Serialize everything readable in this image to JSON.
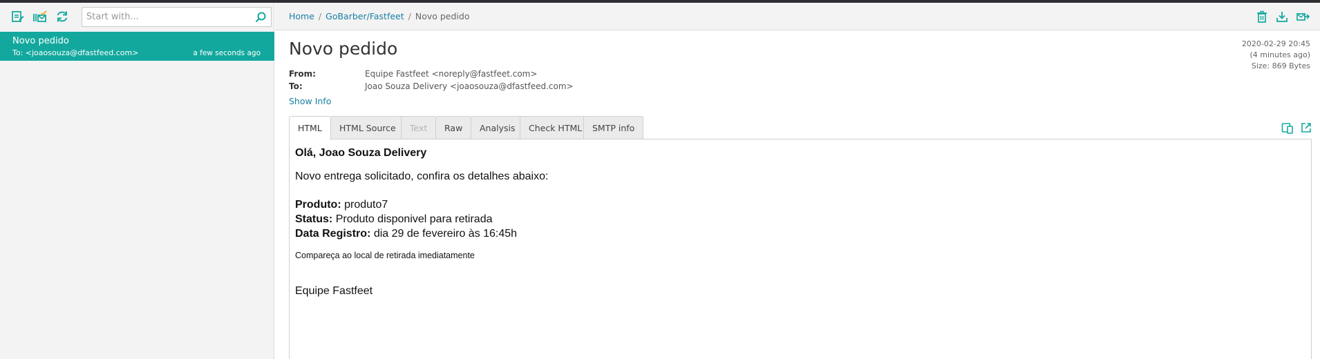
{
  "colors": {
    "accent": "#13a89e",
    "link": "#1a7fa3",
    "sidebar_bg": "#f3f3f3"
  },
  "toolbar": {
    "icons": [
      "compose-icon",
      "mark-all-read-icon",
      "refresh-icon"
    ],
    "search": {
      "placeholder": "Start with...",
      "value": ""
    }
  },
  "messages": [
    {
      "subject": "Novo pedido",
      "to": "To: <joaosouza@dfastfeed.com>",
      "time": "a few seconds ago",
      "selected": true
    }
  ],
  "header": {
    "breadcrumb": [
      "Home",
      "GoBarber/Fastfeet",
      "Novo pedido"
    ],
    "actions": [
      "delete-icon",
      "download-icon",
      "forward-icon"
    ]
  },
  "message": {
    "title": "Novo pedido",
    "from_label": "From:",
    "from": "Equipe Fastfeet <noreply@fastfeet.com>",
    "to_label": "To:",
    "to": "Joao Souza Delivery <joaosouza@dfastfeed.com>",
    "show_info": "Show Info",
    "date": "2020-02-29 20:45",
    "ago": "(4 minutes ago)",
    "size": "Size: 869 Bytes"
  },
  "tabs": [
    {
      "label": "HTML",
      "state": "active"
    },
    {
      "label": "HTML Source",
      "state": "normal"
    },
    {
      "label": "Text",
      "state": "disabled"
    },
    {
      "label": "Raw",
      "state": "normal"
    },
    {
      "label": "Analysis",
      "state": "normal"
    },
    {
      "label": "Check HTML",
      "state": "normal"
    },
    {
      "label": "SMTP info",
      "state": "normal"
    }
  ],
  "body": {
    "greeting": "Olá, Joao Souza Delivery",
    "intro": "Novo entrega solicitado, confira os detalhes abaixo:",
    "fields": [
      {
        "label": "Produto:",
        "value": "produto7"
      },
      {
        "label": "Status:",
        "value": "Produto disponivel para retirada"
      },
      {
        "label": "Data Registro:",
        "value": "dia 29 de fevereiro às 16:45h"
      }
    ],
    "note": "Compareça ao local de retirada imediatamente",
    "signature": "Equipe Fastfeet"
  }
}
